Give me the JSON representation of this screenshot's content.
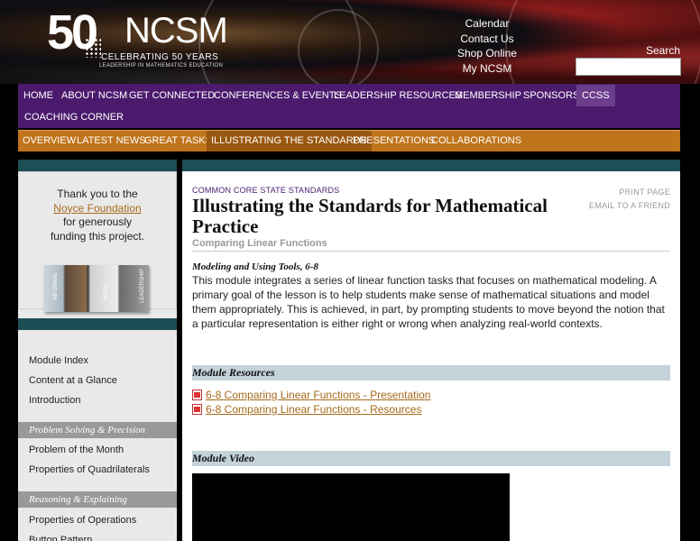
{
  "header": {
    "logo_fifty": "50",
    "logo_name": "NCSM",
    "logo_tagline": "CELEBRATING 50 YEARS",
    "logo_sub": "LEADERSHIP IN MATHEMATICS EDUCATION",
    "top_links": [
      "Calendar",
      "Contact Us",
      "Shop Online",
      "My NCSM"
    ],
    "search_label": "Search",
    "search_placeholder": ""
  },
  "nav_main": [
    "HOME",
    "ABOUT NCSM",
    "GET CONNECTED",
    "CONFERENCES & EVENTS",
    "LEADERSHIP RESOURCES",
    "MEMBERSHIP",
    "SPONSORS",
    "CCSS",
    "COACHING CORNER"
  ],
  "nav_sub": [
    "OVERVIEW",
    "LATEST NEWS",
    "GREAT TASKS",
    "ILLUSTRATING THE STANDARDS",
    "PRESENTATIONS",
    "COLLABORATIONS"
  ],
  "sidebar": {
    "thanks_line1": "Thank you to the",
    "thanks_link": "Noyce Foundation",
    "thanks_line2": "for generously",
    "thanks_line3": "funding this project.",
    "book_text_left": "INFORMAL",
    "book_text_mid": "MATH",
    "book_text_right": "LEADERSHIP",
    "group1": [
      "Module Index",
      "Content at a Glance",
      "Introduction"
    ],
    "heading2": "Problem Solving & Precision",
    "group2": [
      "Problem of the Month",
      "Properties of Quadrilaterals"
    ],
    "heading3": "Reasoning & Explaining",
    "group3": [
      "Properties of Operations",
      "Button Pattern"
    ]
  },
  "main": {
    "eyebrow": "COMMON CORE STATE STANDARDS",
    "title": "Illustrating the Standards for Mathematical Practice",
    "subtitle": "Comparing Linear Functions",
    "print": "PRINT PAGE",
    "email": "EMAIL TO A FRIEND",
    "module_head": "Modeling and Using Tools, 6-8",
    "intro": "This module integrates a series of linear function tasks that focuses on mathematical modeling. A primary goal of the lesson is to help students make sense of mathematical situations and model them appropriately. This is achieved, in part, by prompting students to move beyond the notion that a particular representation is either right or wrong when analyzing real-world contexts.",
    "resources_head": "Module Resources",
    "resource1": "6-8 Comparing Linear Functions - Presentation",
    "resource2": "6-8 Comparing Linear Functions - Resources",
    "video_head": "Module Video"
  },
  "colors": {
    "nav_purple": "#4b1a6d",
    "sub_orange": "#c0741c",
    "teal": "#1d4e55",
    "link_gold": "#a66a1a",
    "section_blue": "#c4d2da"
  }
}
